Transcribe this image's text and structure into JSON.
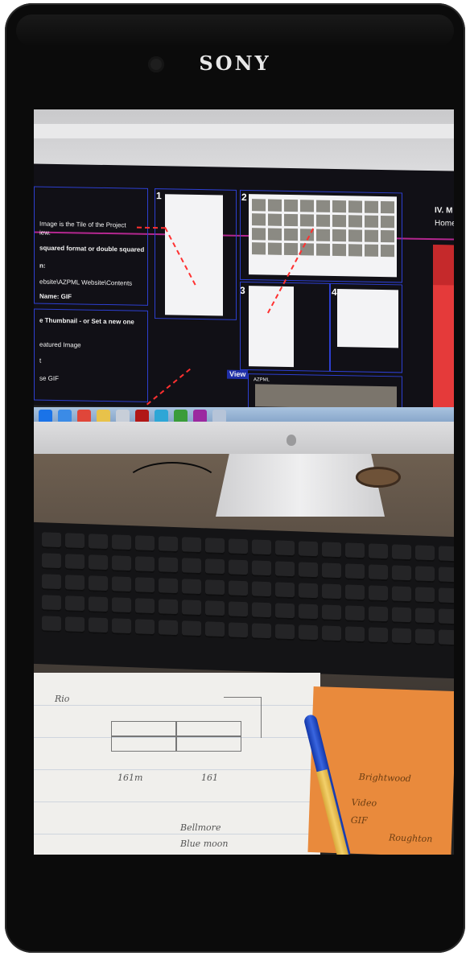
{
  "device": {
    "brand": "SONY"
  },
  "monitor_screen": {
    "left_panel": {
      "lines": [
        "Image is the Tile of the Project",
        "iew.",
        "squared format or double squared",
        "n:",
        "ebsite\\AZPML Website\\Contents",
        "Name: GIF"
      ]
    },
    "left_panel_2": {
      "lines": [
        "e Thumbnail - or Set a new one",
        "eatured Image",
        "t",
        "se GIF"
      ]
    },
    "step_numbers": [
      "1",
      "2",
      "3",
      "4"
    ],
    "view_label": "View",
    "media_strip_label": "AZPML",
    "right_admin": {
      "title": "IV. M",
      "menu": "Home"
    }
  },
  "notebook": {
    "words": [
      "Bellmore",
      "Blue moon",
      "161m",
      "161",
      "Rio"
    ]
  },
  "orange_card": {
    "words": [
      "Brightwood",
      "Video",
      "GIF",
      "Roughton"
    ]
  },
  "colors": {
    "phone_body": "#0b0b0b",
    "annotation_dash": "#ff3030",
    "panel_border": "#2d3fd0",
    "admin_red": "#e53a3a",
    "orange_card": "#e98a3c"
  }
}
